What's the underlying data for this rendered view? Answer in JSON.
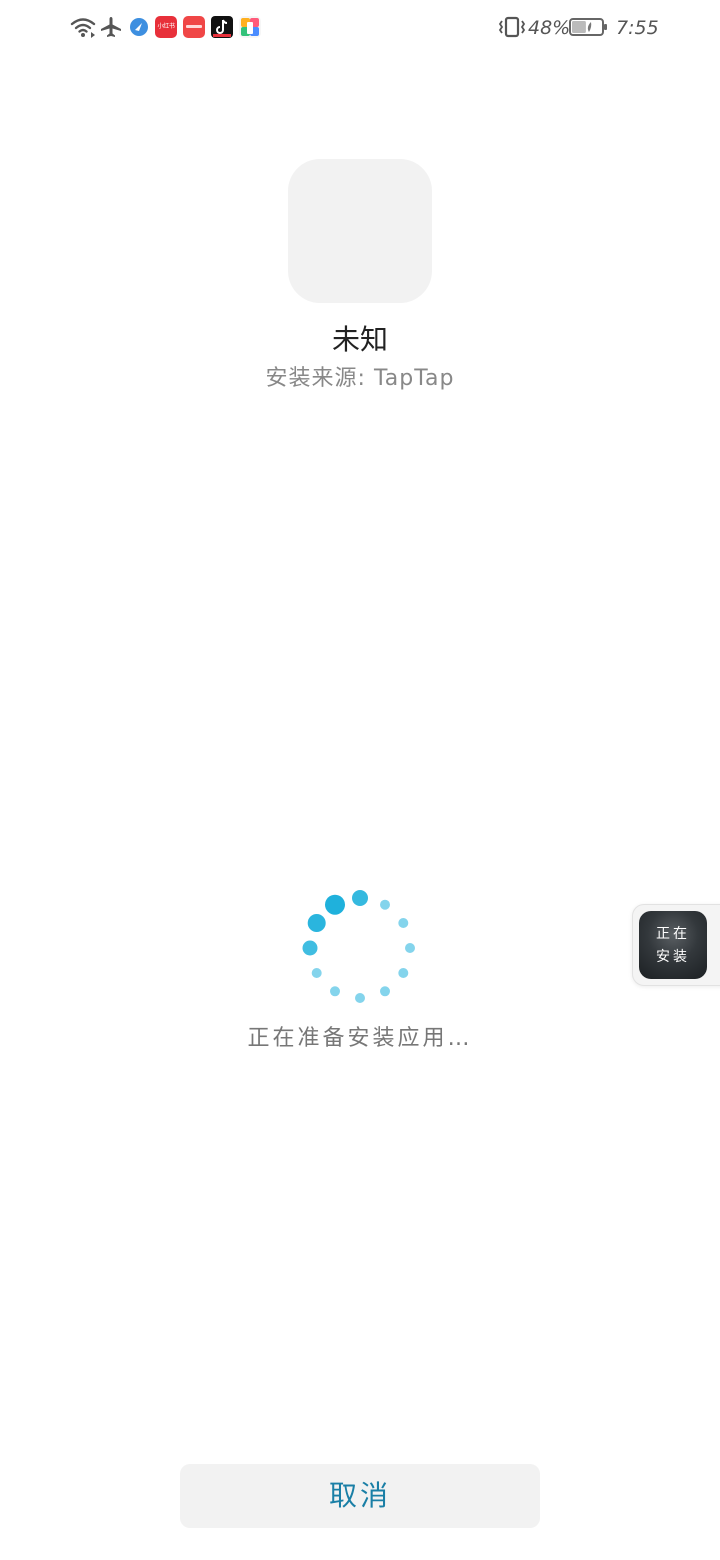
{
  "status_bar": {
    "battery_percent": "48%",
    "time": "7:55",
    "battery_level": 0.48,
    "notification_icons": [
      {
        "name": "browser-app-icon",
        "color": "#3d8fe0"
      },
      {
        "name": "red-app-icon",
        "label": "小红书",
        "color": "#e8303a"
      },
      {
        "name": "red-app-icon-2",
        "color": "#f04646"
      },
      {
        "name": "tiktok-app-icon",
        "color": "#111111"
      },
      {
        "name": "colorful-app-icon",
        "color": "#ffb020"
      }
    ]
  },
  "app": {
    "name": "未知",
    "install_source": "安装来源: TapTap"
  },
  "progress": {
    "message": "正在准备安装应用…"
  },
  "floating_bubble": {
    "line1": "正在",
    "line2": "安装"
  },
  "actions": {
    "cancel_label": "取消"
  },
  "colors": {
    "accent": "#1a7fa6",
    "spinner": "#1fb1dc"
  }
}
